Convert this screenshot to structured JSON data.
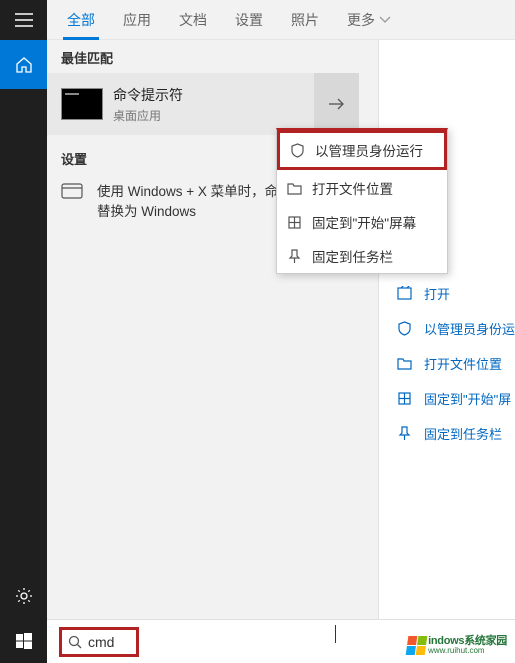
{
  "tabs": {
    "items": [
      "全部",
      "应用",
      "文档",
      "设置",
      "照片",
      "更多"
    ],
    "active_index": 0
  },
  "best_match": {
    "header": "最佳匹配",
    "title": "命令提示符",
    "subtitle": "桌面应用"
  },
  "settings": {
    "header": "设置",
    "item_text": "使用 Windows + X 菜单时，命令提示符替换为 Windows"
  },
  "context_menu": {
    "items": [
      {
        "label": "以管理员身份运行",
        "highlighted": true
      },
      {
        "label": "打开文件位置",
        "highlighted": false
      },
      {
        "label": "固定到\"开始\"屏幕",
        "highlighted": false
      },
      {
        "label": "固定到任务栏",
        "highlighted": false
      }
    ]
  },
  "preview_actions": {
    "items": [
      "打开",
      "以管理员身份运",
      "打开文件位置",
      "固定到\"开始\"屏",
      "固定到任务栏"
    ]
  },
  "search": {
    "value": "cmd"
  },
  "watermark": {
    "line1": "indows系统家园",
    "line2": "www.ruihut.com"
  }
}
